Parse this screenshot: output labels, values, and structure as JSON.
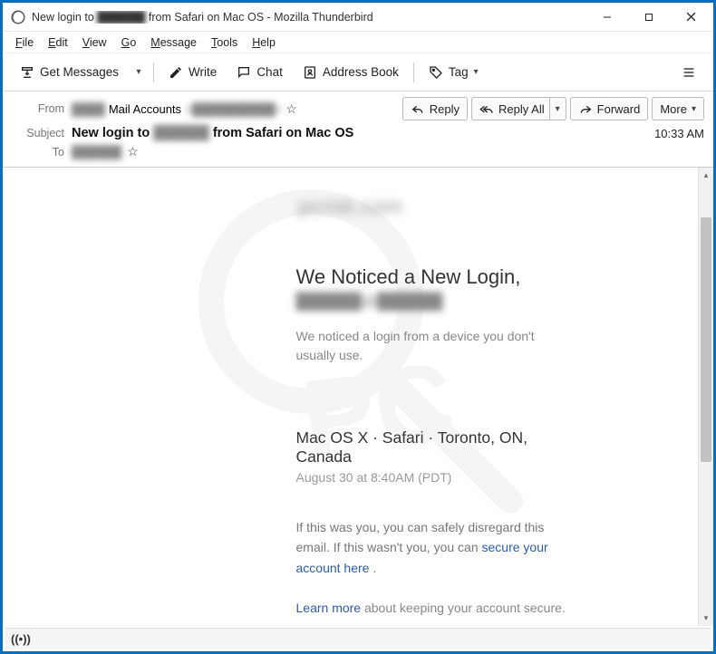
{
  "window": {
    "title_prefix": "New login to",
    "title_blur": "██████",
    "title_suffix": "from Safari on Mac OS - Mozilla Thunderbird"
  },
  "menubar": [
    "File",
    "Edit",
    "View",
    "Go",
    "Message",
    "Tools",
    "Help"
  ],
  "toolbar": {
    "get_messages": "Get Messages",
    "write": "Write",
    "chat": "Chat",
    "address_book": "Address Book",
    "tag": "Tag"
  },
  "header": {
    "from_label": "From",
    "from_blur1": "████",
    "from_mailaccts": "Mail Accounts",
    "from_blur2": "<██████████>",
    "subject_label": "Subject",
    "subject_prefix": "New login to",
    "subject_blur": "██████",
    "subject_suffix": "from Safari on Mac OS",
    "to_label": "To",
    "to_blur": "██████",
    "time": "10:33 AM",
    "actions": {
      "reply": "Reply",
      "reply_all": "Reply All",
      "forward": "Forward",
      "more": "More"
    }
  },
  "mail": {
    "logo_text": "pcrisk.com",
    "heading": "We Noticed a New Login,",
    "email_blur": "██████@██████",
    "para1": "We noticed a login from a device you don't usually use.",
    "device_line": "Mac OS X · Safari · Toronto, ON, Canada",
    "timestamp": "August 30  at 8:40AM (PDT)",
    "note_pre": "If this was you, you can safely disregard this email. If this wasn't you, you can ",
    "note_link": "secure your account here",
    "note_post": " .",
    "learn_link": "Learn more",
    "learn_rest": " about keeping your account secure."
  },
  "statusbar": {
    "icon": "((•))"
  }
}
